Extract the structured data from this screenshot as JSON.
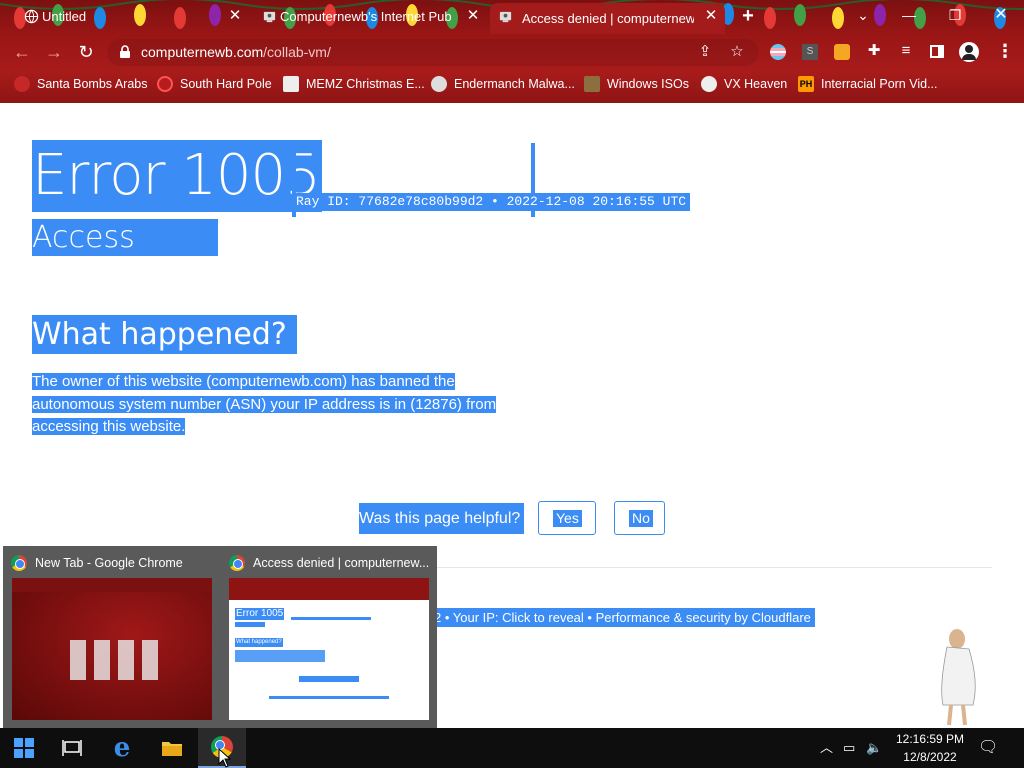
{
  "browser": {
    "tabs": [
      {
        "title": "Untitled",
        "active": false
      },
      {
        "title": "Computernewb's Internet Pub H",
        "active": false
      },
      {
        "title": "Access denied | computernewb.c",
        "active": true
      }
    ],
    "address": {
      "domain": "computernewb.com",
      "path": "/collab-vm/"
    },
    "bookmarks": [
      {
        "label": "Santa Bombs Arabs",
        "icon": "bomb-icon"
      },
      {
        "label": "South Hard Pole",
        "icon": "virus-icon"
      },
      {
        "label": "MEMZ Christmas E...",
        "icon": "page-icon"
      },
      {
        "label": "Endermanch Malwa...",
        "icon": "skull-icon"
      },
      {
        "label": "Windows ISOs",
        "icon": "figure-icon"
      },
      {
        "label": "VX Heaven",
        "icon": "biohazard-icon"
      },
      {
        "label": "Interracial Porn Vid...",
        "icon": "ph-icon",
        "icon_text": "PH"
      }
    ],
    "theme_color": "#9b1616"
  },
  "page": {
    "error_title": "Error 1005",
    "ray_line": "Ray ID: 77682e78c80b99d2 • 2022-12-08 20:16:55 UTC",
    "subtitle": "Access denied",
    "what_heading": "What happened?",
    "description_lines": [
      "The owner of this website (computernewb.com) has banned the",
      "autonomous system number (ASN) your IP address is in (12876) from",
      "accessing this website."
    ],
    "helpful_question": "Was this page helpful?",
    "yes_label": "Yes",
    "no_label": "No",
    "footer_text": "2 • Your IP: Click to reveal • Performance & security by Cloudflare",
    "selection_color": "#3b8cf5"
  },
  "taskbar_previews": [
    {
      "title": "New Tab - Google Chrome"
    },
    {
      "title": "Access denied | computernew..."
    }
  ],
  "taskbar": {
    "time": "12:16:59 PM",
    "date": "12/8/2022"
  },
  "thumbnail_text": {
    "title": "Error 1005",
    "heading": "What happened?"
  }
}
